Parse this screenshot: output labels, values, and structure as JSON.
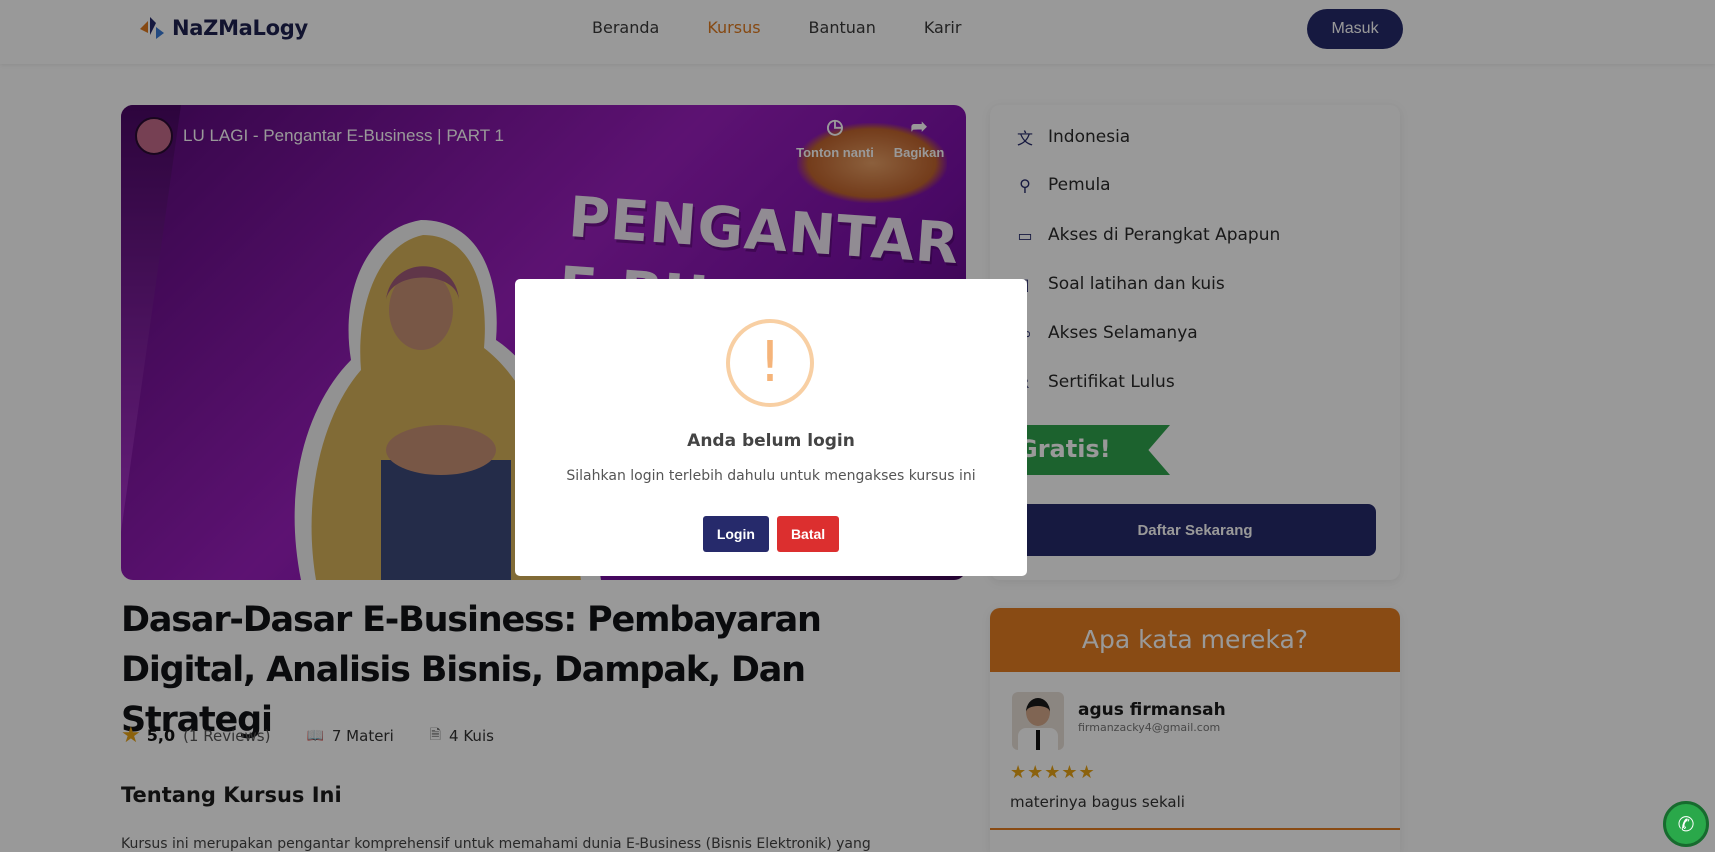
{
  "brand": {
    "name": "NaZMaLogy"
  },
  "nav": {
    "items": [
      {
        "label": "Beranda",
        "active": false
      },
      {
        "label": "Kursus",
        "active": true
      },
      {
        "label": "Bantuan",
        "active": false
      },
      {
        "label": "Karir",
        "active": false
      }
    ],
    "login_label": "Masuk"
  },
  "video": {
    "title": "LU LAGI - Pengantar E-Business | PART 1",
    "overlay_text_line1": "PENGANTAR",
    "overlay_text_line2": "E-BU",
    "watch_later_label": "Tonton nanti",
    "share_label": "Bagikan"
  },
  "course": {
    "title": "Dasar-Dasar E-Business: Pembayaran Digital, Analisis Bisnis, Dampak, Dan Strategi",
    "rating": "5,0",
    "reviews": "(1 Reviews)",
    "materi": "7 Materi",
    "kuis": "4 Kuis",
    "about_heading": "Tentang Kursus Ini",
    "about_text": "Kursus ini merupakan pengantar komprehensif untuk memahami dunia E-Business (Bisnis Elektronik) yang"
  },
  "features": [
    {
      "label": "Indonesia",
      "icon": "translate-icon"
    },
    {
      "label": "Pemula",
      "icon": "level-icon"
    },
    {
      "label": "Akses di Perangkat Apapun",
      "icon": "devices-icon"
    },
    {
      "label": "Soal latihan dan kuis",
      "icon": "document-icon"
    },
    {
      "label": "Akses Selamanya",
      "icon": "infinity-icon"
    },
    {
      "label": "Sertifikat Lulus",
      "icon": "certificate-icon"
    }
  ],
  "pricing": {
    "badge": "Gratis!",
    "cta": "Daftar Sekarang"
  },
  "testimonial": {
    "heading": "Apa kata mereka?",
    "name": "agus firmansah",
    "email": "firmanzacky4@gmail.com",
    "stars": "★★★★★",
    "text": "materinya bagus sekali"
  },
  "modal": {
    "icon": "!",
    "title": "Anda belum login",
    "message": "Silahkan login terlebih dahulu untuk mengakses kursus ini",
    "confirm_label": "Login",
    "cancel_label": "Batal"
  },
  "colors": {
    "primary": "#262a6b",
    "accent": "#e07a1f",
    "danger": "#dc2f2f",
    "success": "#2fa34d",
    "overlay": "rgba(0,0,0,0.4)"
  }
}
